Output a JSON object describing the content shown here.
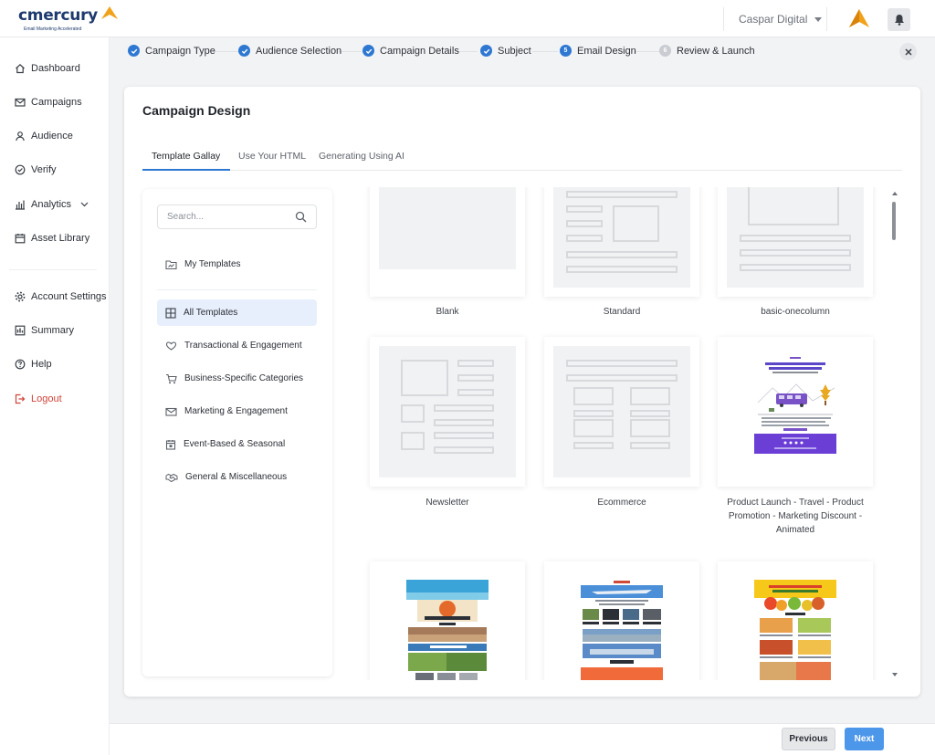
{
  "app": {
    "logo_text": "cmercury",
    "logo_tagline": "Email Marketing Accelerated",
    "organization": "Caspar Digital",
    "colors": {
      "primary": "#2e78d2",
      "brand_orange": "#f0a21a",
      "logout": "#d0453a",
      "next_button": "#4d97ea"
    }
  },
  "sidebar": {
    "items": [
      {
        "label": "Dashboard",
        "icon": "home-icon"
      },
      {
        "label": "Campaigns",
        "icon": "mail-icon"
      },
      {
        "label": "Audience",
        "icon": "user-icon"
      },
      {
        "label": "Verify",
        "icon": "check-circle-icon"
      },
      {
        "label": "Analytics",
        "icon": "bar-chart-icon"
      },
      {
        "label": "Asset Library",
        "icon": "calendar-icon"
      },
      {
        "label": "Account Settings",
        "icon": "gear-icon"
      },
      {
        "label": "Summary",
        "icon": "summary-icon"
      },
      {
        "label": "Help",
        "icon": "help-icon"
      },
      {
        "label": "Logout",
        "icon": "logout-icon"
      }
    ]
  },
  "stepper": {
    "steps": [
      {
        "label": "Campaign Type",
        "state": "done"
      },
      {
        "label": "Audience Selection",
        "state": "done"
      },
      {
        "label": "Campaign Details",
        "state": "done"
      },
      {
        "label": "Subject",
        "state": "done"
      },
      {
        "label": "Email Design",
        "state": "current",
        "number": "5"
      },
      {
        "label": "Review & Launch",
        "state": "pending",
        "number": "6"
      }
    ]
  },
  "main": {
    "title": "Campaign Design",
    "tabs": [
      {
        "label": "Template Gallay",
        "active": true
      },
      {
        "label": "Use Your HTML",
        "active": false
      },
      {
        "label": "Generating Using AI",
        "active": false
      }
    ]
  },
  "categories": {
    "search_placeholder": "Search...",
    "my_templates": "My Templates",
    "items": [
      {
        "label": "All Templates",
        "icon": "grid-icon",
        "active": true
      },
      {
        "label": "Transactional & Engagement",
        "icon": "heart-hand-icon"
      },
      {
        "label": "Business-Specific Categories",
        "icon": "cart-icon"
      },
      {
        "label": "Marketing & Engagement",
        "icon": "envelope-icon"
      },
      {
        "label": "Event-Based & Seasonal",
        "icon": "calendar-event-icon"
      },
      {
        "label": "General & Miscellaneous",
        "icon": "handshake-icon"
      }
    ]
  },
  "templates": [
    {
      "name": "Blank"
    },
    {
      "name": "Standard"
    },
    {
      "name": "basic-onecolumn"
    },
    {
      "name": "Newsletter"
    },
    {
      "name": "Ecommerce"
    },
    {
      "name": "Product Launch - Travel - Product Promotion - Marketing Discount - Animated"
    }
  ],
  "footer": {
    "previous": "Previous",
    "next": "Next"
  }
}
